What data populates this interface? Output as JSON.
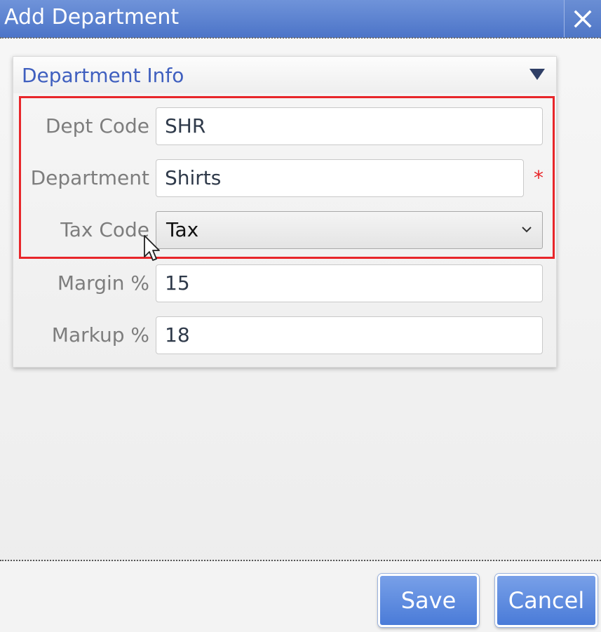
{
  "dialog": {
    "title": "Add Department",
    "close_icon": "close-icon"
  },
  "panel": {
    "title": "Department Info",
    "toggle_icon": "triangle-down-icon"
  },
  "form": {
    "dept_code": {
      "label": "Dept Code",
      "value": "SHR"
    },
    "department": {
      "label": "Department",
      "value": "Shirts",
      "required_mark": "*"
    },
    "tax_code": {
      "label": "Tax Code",
      "value": "Tax"
    },
    "margin": {
      "label": "Margin %",
      "value": "15"
    },
    "markup": {
      "label": "Markup %",
      "value": "18"
    }
  },
  "buttons": {
    "save": "Save",
    "cancel": "Cancel"
  },
  "colors": {
    "title_bar": "#4c74c8",
    "highlight": "#e8262a",
    "panel_title": "#3f5fbf",
    "button": "#4a7bd8"
  }
}
